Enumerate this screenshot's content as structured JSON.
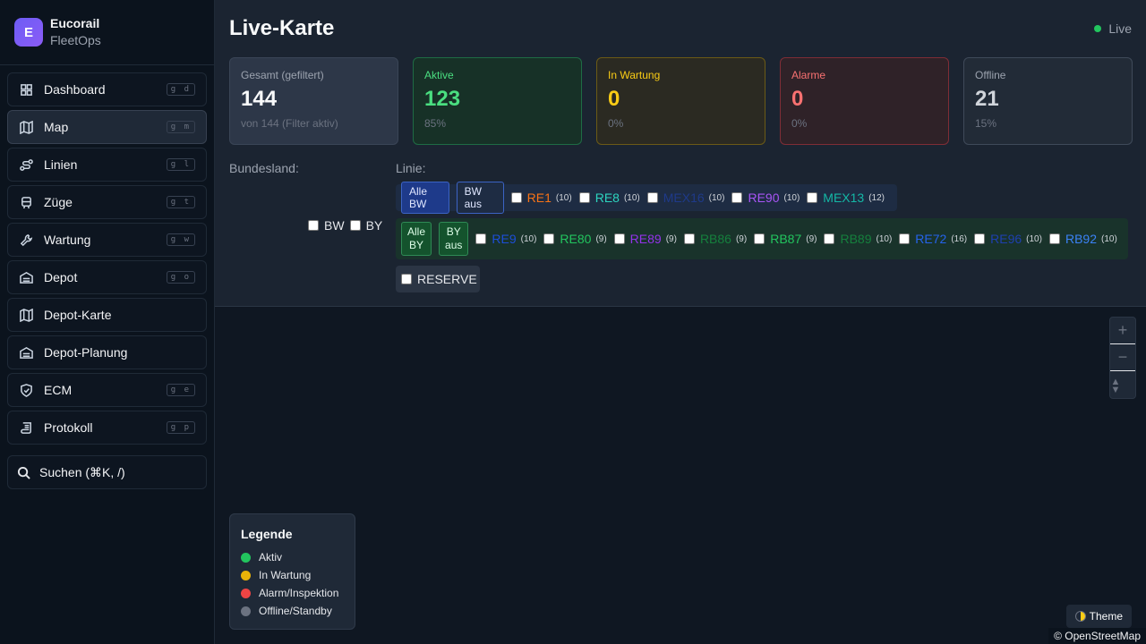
{
  "brand": {
    "initial": "E",
    "name": "Eucorail",
    "sub": "FleetOps"
  },
  "nav": [
    {
      "label": "Dashboard",
      "kbd": "g d",
      "icon": "dashboard-icon",
      "active": false
    },
    {
      "label": "Map",
      "kbd": "g m",
      "icon": "map-icon",
      "active": true
    },
    {
      "label": "Linien",
      "kbd": "g l",
      "icon": "route-icon",
      "active": false
    },
    {
      "label": "Züge",
      "kbd": "g t",
      "icon": "train-icon",
      "active": false
    },
    {
      "label": "Wartung",
      "kbd": "g w",
      "icon": "wrench-icon",
      "active": false
    },
    {
      "label": "Depot",
      "kbd": "g o",
      "icon": "warehouse-icon",
      "active": false
    },
    {
      "label": "Depot-Karte",
      "kbd": "",
      "icon": "map-icon",
      "active": false
    },
    {
      "label": "Depot-Planung",
      "kbd": "",
      "icon": "warehouse-icon",
      "active": false
    },
    {
      "label": "ECM",
      "kbd": "g e",
      "icon": "shield-icon",
      "active": false
    },
    {
      "label": "Protokoll",
      "kbd": "g p",
      "icon": "scroll-icon",
      "active": false
    }
  ],
  "search": {
    "label": "Suchen (⌘K, /)"
  },
  "header": {
    "title": "Live-Karte",
    "status": "Live"
  },
  "cards": [
    {
      "label": "Gesamt (gefiltert)",
      "value": "144",
      "sub": "von 144 (Filter aktiv)"
    },
    {
      "label": "Aktive",
      "value": "123",
      "sub": "85%"
    },
    {
      "label": "In Wartung",
      "value": "0",
      "sub": "0%"
    },
    {
      "label": "Alarme",
      "value": "0",
      "sub": "0%"
    },
    {
      "label": "Offline",
      "value": "21",
      "sub": "15%"
    }
  ],
  "filters": {
    "state_label": "Bundesland:",
    "line_label": "Linie:",
    "states": [
      "BW",
      "BY"
    ],
    "bw_buttons": {
      "all": "Alle BW",
      "off": "BW aus"
    },
    "by_buttons": {
      "all": "Alle\nBY",
      "off": "BY\naus"
    },
    "bw_lines": [
      {
        "name": "RE1",
        "count": "(10)",
        "color": "#f97316"
      },
      {
        "name": "RE8",
        "count": "(10)",
        "color": "#2dd4bf"
      },
      {
        "name": "MEX16",
        "count": "(10)",
        "color": "#1e3a8a"
      },
      {
        "name": "RE90",
        "count": "(10)",
        "color": "#a855f7"
      },
      {
        "name": "MEX13",
        "count": "(12)",
        "color": "#14b8a6"
      }
    ],
    "by_lines": [
      {
        "name": "RE9",
        "count": "(10)",
        "color": "#1d4ed8"
      },
      {
        "name": "RE80",
        "count": "(9)",
        "color": "#22c55e"
      },
      {
        "name": "RE89",
        "count": "(9)",
        "color": "#9333ea"
      },
      {
        "name": "RB86",
        "count": "(9)",
        "color": "#15803d"
      },
      {
        "name": "RB87",
        "count": "(9)",
        "color": "#22c55e"
      },
      {
        "name": "RB89",
        "count": "(10)",
        "color": "#15803d"
      },
      {
        "name": "RE72",
        "count": "(16)",
        "color": "#2563eb"
      },
      {
        "name": "RE96",
        "count": "(10)",
        "color": "#1e40af"
      },
      {
        "name": "RB92",
        "count": "(10)",
        "color": "#3b82f6"
      }
    ],
    "reserve": "RESERVE"
  },
  "map": {
    "zoom_in": "+",
    "zoom_out": "−",
    "reset": "▲▼",
    "legend_title": "Legende",
    "legend": [
      {
        "label": "Aktiv",
        "color": "#22c55e"
      },
      {
        "label": "In Wartung",
        "color": "#eab308"
      },
      {
        "label": "Alarm/Inspektion",
        "color": "#ef4444"
      },
      {
        "label": "Offline/Standby",
        "color": "#6b7280"
      }
    ],
    "theme": "Theme",
    "attribution": "© OpenStreetMap"
  }
}
